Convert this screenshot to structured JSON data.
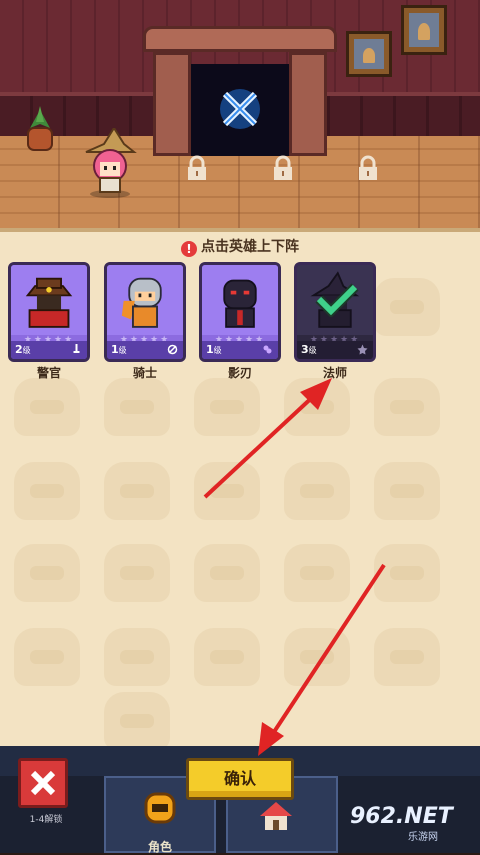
{
  "panel": {
    "hint": "点击英雄上下阵",
    "hint_icon": "exclamation-icon"
  },
  "heroes": [
    {
      "name": "警官",
      "level": "2",
      "level_suffix": "级",
      "slot_icon": "sword-icon",
      "selected": false
    },
    {
      "name": "骑士",
      "level": "1",
      "level_suffix": "级",
      "slot_icon": "shield-icon",
      "selected": false
    },
    {
      "name": "影刃",
      "level": "1",
      "level_suffix": "级",
      "slot_icon": "shadow-icon",
      "selected": false
    },
    {
      "name": "法师",
      "level": "3",
      "level_suffix": "级",
      "slot_icon": "star-icon",
      "selected": true
    }
  ],
  "buttons": {
    "confirm": "确认",
    "close_icon": "close-x-icon"
  },
  "bottom": {
    "nav_label": "角色",
    "left_label": "1-4解锁"
  },
  "watermark": {
    "text": "962.NET",
    "sub": "乐游网"
  },
  "colors": {
    "panel_bg": "#f3e3c3",
    "card_purple": "#8c6be0",
    "confirm_yellow": "#f4cc2a",
    "close_red": "#d93a3a",
    "arrow_red": "#e02424"
  }
}
